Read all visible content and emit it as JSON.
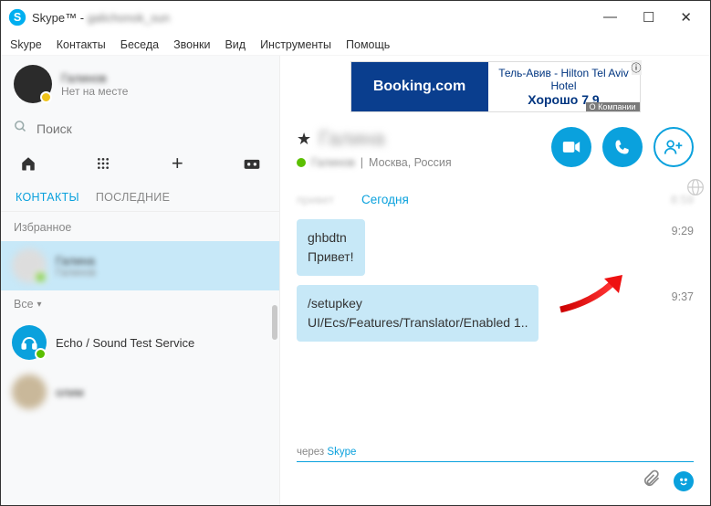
{
  "window": {
    "app_name": "Skype™",
    "username_blurred": "galichonok_sun"
  },
  "menu": [
    "Skype",
    "Контакты",
    "Беседа",
    "Звонки",
    "Вид",
    "Инструменты",
    "Помощь"
  ],
  "profile": {
    "name_blurred": "Галинов",
    "status": "Нет на месте"
  },
  "search": {
    "placeholder": "Поиск"
  },
  "tabs": {
    "contacts": "КОНТАКТЫ",
    "recent": "ПОСЛЕДНИЕ"
  },
  "sections": {
    "favorites": "Избранное",
    "all": "Все"
  },
  "contacts": {
    "selected": {
      "name_blurred": "Галина",
      "sub_blurred": "Галинов"
    },
    "echo": {
      "name": "Echo / Sound Test Service"
    },
    "other": {
      "name_blurred": "олим"
    }
  },
  "ad": {
    "brand": "Booking.com",
    "line1": "Тель-Авив - Hilton Tel Aviv Hotel",
    "rating_label": "Хорошо 7.9",
    "badge": "ⓘ",
    "footer": "О Компании"
  },
  "chat": {
    "title_blurred": "Галина",
    "sub_blurred": "Галинов",
    "location": "Москва, Россия",
    "day_prev_blurred": "привет",
    "day_today": "Сегодня",
    "day_time_blurred": "8:59",
    "messages": [
      {
        "lines": [
          "ghbdtn",
          "Привет!"
        ],
        "time": "9:29"
      },
      {
        "lines": [
          "/setupkey",
          "UI/Ecs/Features/Translator/Enabled 1.."
        ],
        "time": "9:37"
      }
    ],
    "via_label": "через",
    "via_link": "Skype"
  }
}
